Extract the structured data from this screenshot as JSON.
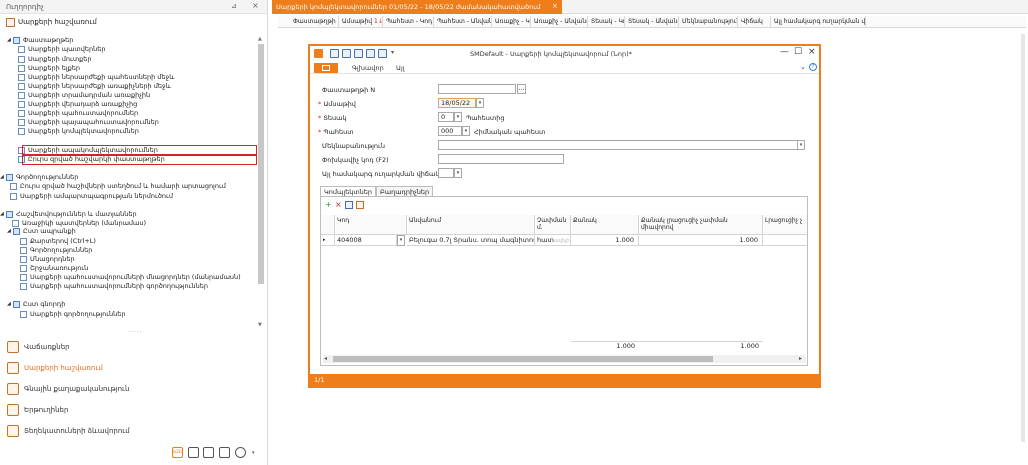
{
  "navigator": {
    "title": "Ուղղորդիչ",
    "pin_icon": "pin-icon",
    "close_glyph": "×",
    "header_module": "Սարքերի հաշվառում",
    "tree": [
      {
        "text": "Փաստաթղթեր",
        "arrow": "◢",
        "kind": "folder"
      },
      {
        "text": "Սարքերի պատվերներ",
        "kind": "doc"
      },
      {
        "text": "Սարքերի մուտքեր",
        "kind": "doc"
      },
      {
        "text": "Սարքերի ելքեր",
        "kind": "doc"
      },
      {
        "text": "Սարքերի ներսարժեքի պահեստների մեջև",
        "kind": "doc"
      },
      {
        "text": "Սարքերի ներսարժեքի առաքիչների մեջև",
        "kind": "doc"
      },
      {
        "text": "Սարքերի տրամադրման առաքիչին",
        "kind": "doc"
      },
      {
        "text": "Սարքերի վերադարձ առաքիչից",
        "kind": "doc"
      },
      {
        "text": "Սարքերի պահուստավորումներ",
        "kind": "doc"
      },
      {
        "text": "Սարքերի պայապահուստավորումներ",
        "kind": "doc"
      },
      {
        "text": "Սարքերի կոմպլեկտավորումներ",
        "kind": "doc",
        "selected": true
      },
      {
        "text": "Սարքերի ապակոմպլեկտավորումներ",
        "kind": "doc",
        "selected": true
      },
      {
        "text": "Ըուրս զրված հաշվարկի փաստաթղթեր",
        "kind": "doc"
      },
      {
        "text": "Գործողություններ",
        "arrow": "◢",
        "kind": "folder"
      },
      {
        "text": "Ըուրս զրված հաշիվների ստեղծում և համարի արտացոլում",
        "kind": "doc"
      },
      {
        "text": "Սարքերի ամպարտպագրության ներմուծում",
        "kind": "doc"
      },
      {
        "text": "Հաշվետվություններ և մատյաններ",
        "arrow": "◢",
        "kind": "folder"
      },
      {
        "text": "Առաջիկի պատվերներ (մանրամաս)",
        "kind": "doc"
      },
      {
        "text": "Ըստ ապրանքի",
        "arrow": "◢",
        "kind": "folder"
      },
      {
        "text": "Քարտերով (Ctrl+L)",
        "kind": "doc"
      },
      {
        "text": "Գործողություններ",
        "kind": "doc"
      },
      {
        "text": "Մնացորդներ",
        "kind": "doc"
      },
      {
        "text": "Շրջանառություն",
        "kind": "doc"
      },
      {
        "text": "Սարքերի պահուստավորումների մնացորդներ (մանրամասն)",
        "kind": "doc"
      },
      {
        "text": "Սարքերի պահուստավորումների գործողություններ",
        "kind": "doc"
      },
      {
        "text": "Ըստ գնորդի",
        "arrow": "◢",
        "kind": "folder"
      },
      {
        "text": "Սարքերի գործողություններ",
        "kind": "doc"
      }
    ],
    "modules": [
      {
        "text": "Վաճառքներ",
        "icon": "handshake-icon"
      },
      {
        "text": "Սարքերի հաշվառում",
        "icon": "box-icon",
        "active": true
      },
      {
        "text": "Գնային քաղաքականություն",
        "icon": "price-tag-icon"
      },
      {
        "text": "Երթուղիներ",
        "icon": "route-icon"
      },
      {
        "text": "Տեղեկատուների ձևավորում",
        "icon": "directory-icon"
      }
    ],
    "toolbar_icons": [
      "b2b-icon",
      "clipboard-icon",
      "users-icon",
      "tools-icon",
      "person-icon",
      "dropdown-icon"
    ]
  },
  "tab": {
    "title": "Սարքերի կոմպլեկտավորումներ 01/05/22 - 18/05/22 ժամանակահատվածում",
    "close_glyph": "×"
  },
  "grid": {
    "columns": [
      {
        "label": "Փաստաթղթի N",
        "sort": "2"
      },
      {
        "label": "Ամսաթիվ",
        "sort": "1"
      },
      {
        "label": "Պահեստ - Կոդ"
      },
      {
        "label": "Պահեստ - Անվանում"
      },
      {
        "label": "Առաքիչ - Կոդ"
      },
      {
        "label": "Առաքիչ - Անվանում"
      },
      {
        "label": "Տեսակ - Կոդ"
      },
      {
        "label": "Տեսակ - Անվանում"
      },
      {
        "label": "Մեկնաբանություն"
      },
      {
        "label": "Վիճակ"
      },
      {
        "label": "Ալլ համակարգ ուղարկման վիճակ"
      }
    ]
  },
  "document": {
    "title": "SMDefault - Սարքերի կոմպլեկտավորում (Նոր)*",
    "window_buttons": {
      "minimize": "—",
      "maximize": "☐",
      "close": "×"
    },
    "ribbon": {
      "file_icon": "file-icon",
      "tabs": [
        "Գլխավոր",
        "Այլ"
      ],
      "help": "?"
    },
    "fields": {
      "doc_number": {
        "label": "Փաստաթղթի N",
        "value": ""
      },
      "date": {
        "label": "Ամսաթիվ",
        "value": "18/05/22"
      },
      "type": {
        "label": "Տեսակ",
        "value": "0",
        "after": "Պահեստից"
      },
      "warehouse": {
        "label": "Պահեստ",
        "value": "000",
        "after": "Հիմնական պահեստ"
      },
      "comment": {
        "label": "Մեկնաբանություն",
        "value": ""
      },
      "doc_code": {
        "label": "Փոխկավիչ կոդ (F2)",
        "value": ""
      },
      "ext_status": {
        "label": "Այլ համակարգ ուղարկման վիճակ",
        "value": ""
      }
    },
    "required_marker": "*",
    "dropdown_glyph": "▾",
    "dots_glyph": "...",
    "subtabs": [
      "Կոմպլեկտներ",
      "Բաղադրիչներ"
    ],
    "lines": {
      "toolbar": {
        "add": "+",
        "delete": "×",
        "copy_icon": "copy-icon",
        "edit_icon": "edit-icon"
      },
      "columns": [
        "Կոդ",
        "Անվանում",
        "Չափման մ.",
        "Քանակ",
        "Քանակ լրացուցիչ չափման միավորով",
        "Լրացուցիչ չ"
      ],
      "row": {
        "marker": "▸",
        "code": "404008",
        "name": "Բելուգա 0.7լ Տրանս. տոպ մագնիտով",
        "unit": "հատ",
        "unit_hint": "ավելի",
        "qty": "1.000",
        "qty_extra": "1.000"
      },
      "totals": {
        "qty": "1.000",
        "qty_extra": "1.000"
      },
      "scroll": {
        "left": "◂",
        "right": "▸"
      }
    },
    "status_text": "1/1"
  }
}
